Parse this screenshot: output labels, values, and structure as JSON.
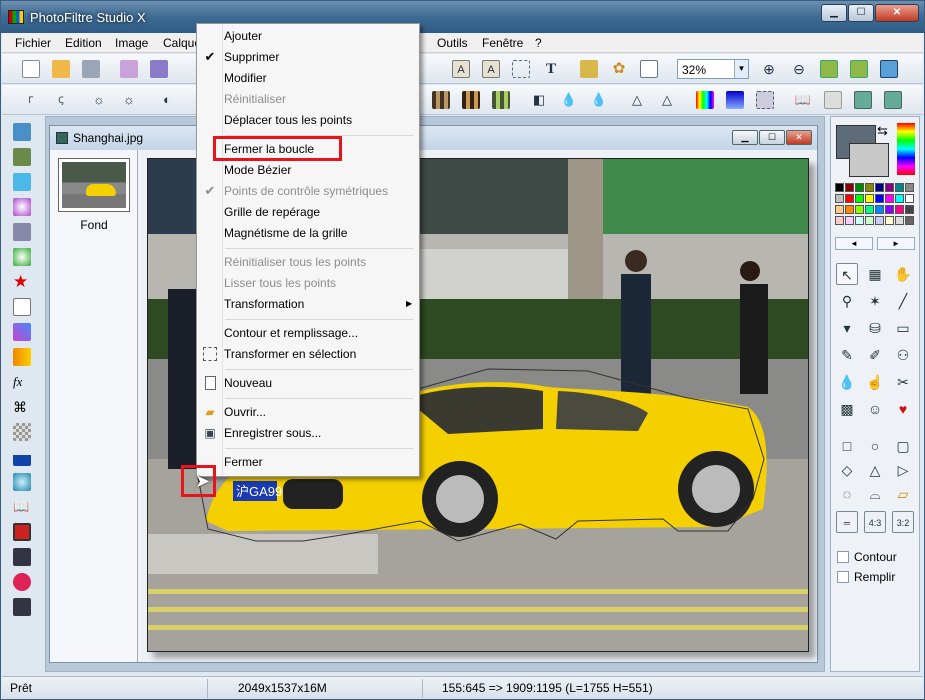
{
  "window": {
    "title": "PhotoFiltre Studio X",
    "minimize": "▁",
    "maximize": "☐",
    "close": "✕"
  },
  "menubar": [
    "Fichier",
    "Edition",
    "Image",
    "Calque",
    "Outils",
    "Fenêtre",
    "?"
  ],
  "toolbar": {
    "zoom_value": "32%"
  },
  "document": {
    "title": "Shanghai.jpg",
    "layer_name": "Fond",
    "plate": "沪GA9918"
  },
  "context_menu": {
    "items": [
      {
        "label": "Ajouter",
        "enabled": true
      },
      {
        "label": "Supprimer",
        "enabled": true,
        "checked": true
      },
      {
        "label": "Modifier",
        "enabled": true
      },
      {
        "label": "Réinitialiser",
        "enabled": false
      },
      {
        "label": "Déplacer tous les points",
        "enabled": true
      },
      {
        "label": "Fermer la boucle",
        "enabled": true,
        "highlighted": true
      },
      {
        "label": "Mode Bézier",
        "enabled": true
      },
      {
        "label": "Points de contrôle symétriques",
        "enabled": false,
        "checked": true
      },
      {
        "label": "Grille de repérage",
        "enabled": true
      },
      {
        "label": "Magnétisme de la grille",
        "enabled": true
      },
      {
        "label": "Réinitialiser tous les points",
        "enabled": false
      },
      {
        "label": "Lisser tous les points",
        "enabled": false
      },
      {
        "label": "Transformation",
        "enabled": true,
        "submenu": true
      },
      {
        "label": "Contour et remplissage...",
        "enabled": true
      },
      {
        "label": "Transformer en sélection",
        "enabled": true
      },
      {
        "label": "Nouveau",
        "enabled": true
      },
      {
        "label": "Ouvrir...",
        "enabled": true
      },
      {
        "label": "Enregistrer sous...",
        "enabled": true
      },
      {
        "label": "Fermer",
        "enabled": true
      }
    ]
  },
  "right_panel": {
    "contour_label": "Contour",
    "remplir_label": "Remplir",
    "ratio_43": "4:3",
    "ratio_32": "3:2"
  },
  "statusbar": {
    "state": "Prêt",
    "image_info": "2049x1537x16M",
    "coords": "155:645 => 1909:1195 (L=1755  H=551)"
  },
  "colors": {
    "accent_red": "#e8141c",
    "car_yellow": "#f5d000",
    "title_blue": "#3e6b93"
  }
}
